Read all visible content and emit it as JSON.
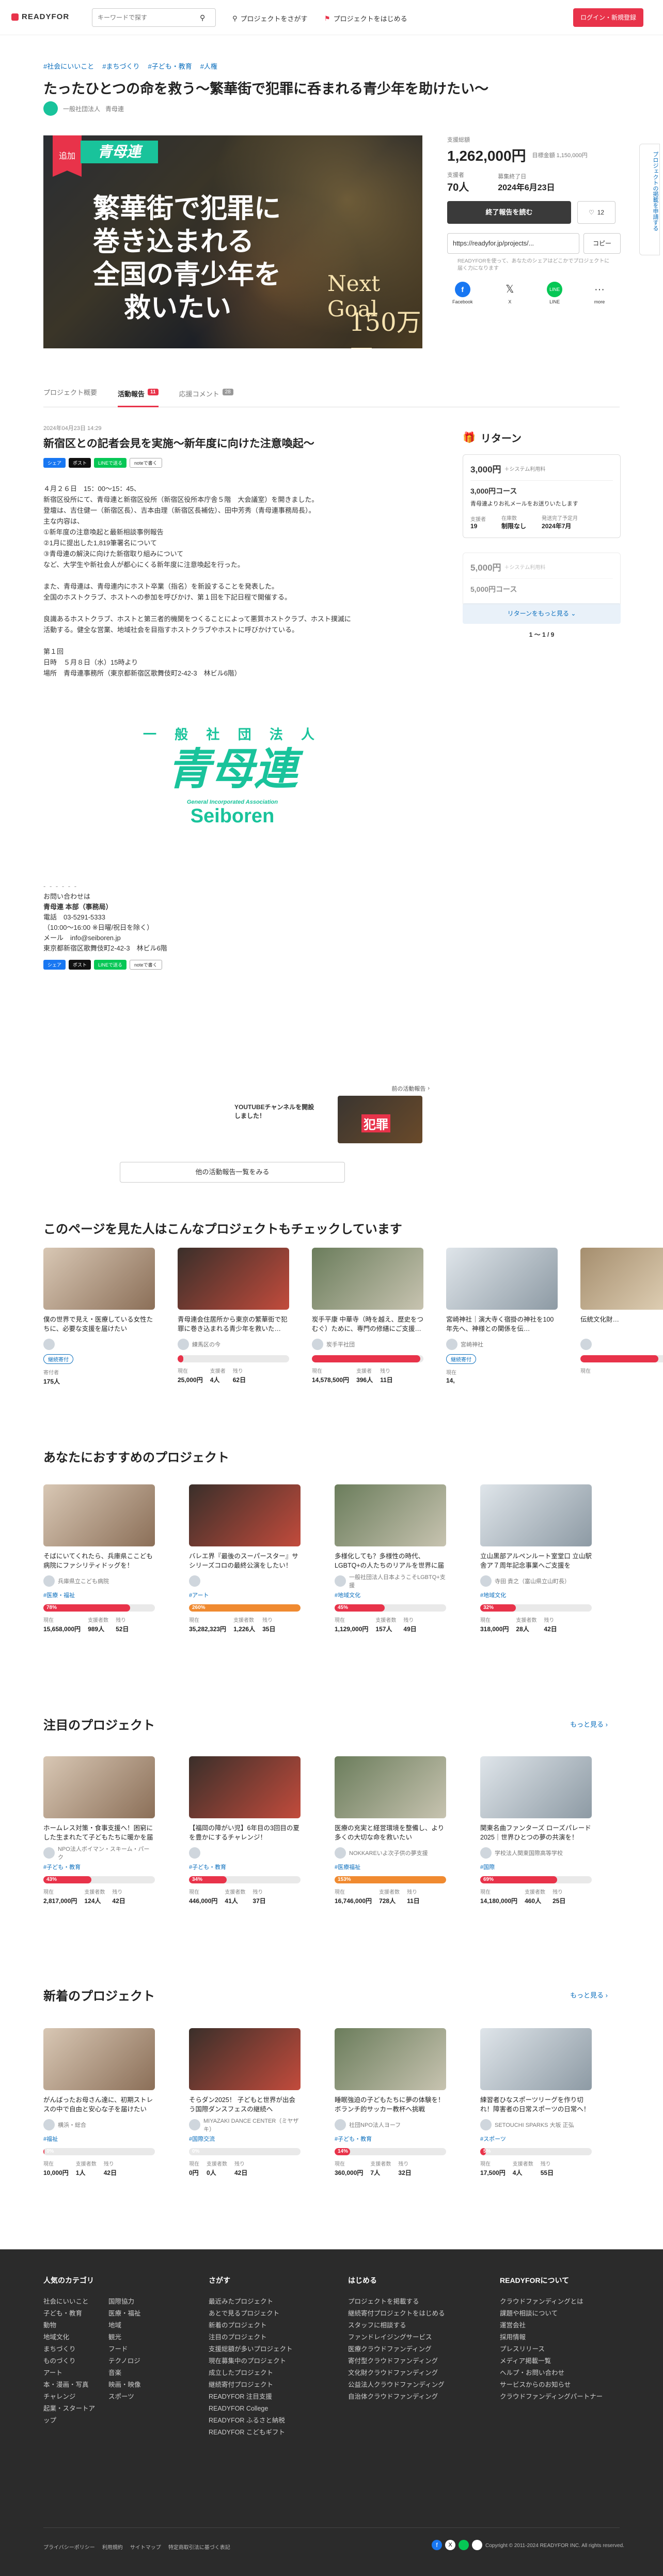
{
  "header": {
    "logo": "READYFOR",
    "search_placeholder": "キーワードで探す",
    "find": "プロジェクトをさがす",
    "start": "プロジェクトをはじめる",
    "login": "ログイン・新規登録"
  },
  "tags": [
    "#社会にいいこと",
    "#まちづくり",
    "#子ども・教育",
    "#人権"
  ],
  "title": "たったひとつの命を救う〜繁華街で犯罪に呑まれる青少年を助けたい〜",
  "org": {
    "label": "一般社団法人",
    "name": "青母連"
  },
  "hero": {
    "badge": "追加",
    "brand": "青母連",
    "line1": "繁華街で犯罪に",
    "line2": "巻き込まれる",
    "line3": "全国の青少年を",
    "line4": "救いたい",
    "goal_label": "Next Goal",
    "goal_amount": "150万円"
  },
  "funding": {
    "label": "支援総額",
    "amount": "1,262,000円",
    "target": "目標金額 1,150,000円",
    "supporters_label": "支援者",
    "supporters": "70人",
    "period_label": "募集終了日",
    "period": "2024年6月23日",
    "ended": "終了報告を読む",
    "fav": "12",
    "share_url": "https://readyfor.jp/projects/...",
    "copy": "コピー",
    "share_note": "READYFORを使って、あなたのシェアはどこかでプロジェクトに届く力になります",
    "sns": [
      "Facebook",
      "X",
      "LINE",
      "more"
    ]
  },
  "side_tab": "プロジェクトの掲載を申請する",
  "tabs": [
    {
      "label": "プロジェクト概要"
    },
    {
      "label": "活動報告",
      "count": "11"
    },
    {
      "label": "応援コメント",
      "count": "28"
    }
  ],
  "report": {
    "date": "2024年04月23日 14:29",
    "title": "新宿区との記者会見を実施〜新年度に向けた注意喚起〜",
    "share": "シェア",
    "post": "ポスト",
    "line": "LINEで送る",
    "note": "noteで書く",
    "paras": [
      "４月２６日　15：00〜15：45、",
      "新宿区役所にて、青母連と新宿区役所（新宿区役所本庁舎５階　大会議室）を開きました。",
      "登壇は、吉住健一（新宿区長）、吉本由理（新宿区長補佐）、田中芳秀（青母連事務局長）。",
      "主な内容は、",
      "①新年度の注意喚起と最新相談事例報告",
      "②1月に提出した1,819筆署名について",
      "③青母連の解決に向けた新宿取り組みについて",
      "など、大学生や新社会人が都心にくる新年度に注意喚起を行った。",
      "",
      "また、青母連は、青母連内にホスト卒業（指名）を新設することを発表した。",
      "全国のホストクラブ、ホストへの参加を呼びかけ、第１回を下記日程で開催する。",
      "",
      "良識あるホストクラブ、ホストと第三者的機関をつくることによって悪質ホストクラブ、ホスト撲滅に",
      "活動する。健全な営業、地域社会を目指すホストクラブやホストに呼びかけている。",
      "",
      "第１回",
      "日時　５月８日（水）15時より",
      "場所　青母連事務所（東京都新宿区歌舞伎町2-42-3　林ビル6階）"
    ],
    "logo_top": "一 般 社 団 法 人",
    "logo_main": "青母連",
    "logo_en1": "General Incorporated Association",
    "logo_en2": "Seiboren",
    "contact": [
      "お問い合わせは",
      "青母連 本部（事務局）",
      "電話　03-5291-5333",
      "（10:00〜16:00 ※日曜/祝日を除く）",
      "メール　info@seiboren.jp",
      "東京都新宿区歌舞伎町2-42-3　林ビル6階"
    ],
    "prev_label": "前の活動報告",
    "prev_title": "YOUTUBEチャンネルを開設しました！",
    "all_reports": "他の活動報告一覧をみる"
  },
  "returns": {
    "title": "リターン",
    "items": [
      {
        "price": "3,000円",
        "tax": "＋システム利用料",
        "name": "3,000円コース",
        "desc": "青母連よりお礼メールをお送りいたします",
        "s_label": "支援者",
        "s": "19",
        "r_label": "在庫数",
        "r": "制限なし",
        "d_label": "発送完了予定月",
        "d": "2024年7月"
      },
      {
        "price": "5,000円",
        "tax": "＋システム利用料",
        "name": "5,000円コース"
      }
    ],
    "more": "リターンをもっと見る",
    "pager": "1 〜 1 / 9"
  },
  "sec1": {
    "title": "このページを見た人はこんなプロジェクトもチェックしています",
    "cards": [
      {
        "title": "僕の世界で見え・医療している女性たちに、必要な支援を届けたい",
        "owner": "",
        "badge": "継続寄付",
        "s1l": "寄付者",
        "s1": "175人",
        "color": "#e8334a",
        "pct": 0
      },
      {
        "title": "青母連会住居所から東京の繁華街で犯罪に巻き込まれる青少年を救いた…",
        "owner": "練馬区の今",
        "badge": "",
        "s1l": "現在",
        "s1": "25,000円",
        "s2l": "支援者",
        "s2": "4人",
        "s3l": "残り",
        "s3": "62日",
        "color": "#e8334a",
        "pct": 5
      },
      {
        "title": "炭手平康 中華寺（時を越え、歴史をつむぐ）ために、専門の修繕にご支援…",
        "owner": "炭手平社団",
        "badge": "",
        "s1l": "現在",
        "s1": "14,578,500円",
        "s2l": "支援者",
        "s2": "396人",
        "s3l": "残り",
        "s3": "11日",
        "color": "#e8334a",
        "pct": 97
      },
      {
        "title": "宮崎神社｜演大寺く宿掛の神社を100年先へ、神様との関係を伝…",
        "owner": "宮崎神社",
        "badge": "継続寄付",
        "s1l": "現在",
        "s1": "14,",
        "color": "#e8334a",
        "pct": 0
      },
      {
        "title": "伝統文化財…",
        "owner": "",
        "badge": "",
        "s1l": "現在",
        "s1": "",
        "color": "#e8334a",
        "pct": 70
      }
    ]
  },
  "sec2": {
    "title": "あなたにおすすめのプロジェクト",
    "cards": [
      {
        "title": "そばにいてくれたら、兵庫県ここども病院にファシリティドッグを！",
        "owner": "兵庫県立こども病院",
        "tag": "#医療・福祉",
        "pct": "78%",
        "p": 78,
        "color": "#e8334a",
        "s1": "15,658,000円",
        "s2": "989人",
        "s3": "52日"
      },
      {
        "title": "バレエ界『最後のスーパースター』サシリーズコロの最終公演をしたい！",
        "owner": "",
        "tag": "#アート",
        "pct": "260%",
        "p": 100,
        "color": "#f08a30",
        "s1": "35,282,323円",
        "s2": "1,226人",
        "s3": "35日"
      },
      {
        "title": "多様化しても？多様性の時代、LGBTQ+の人たちのリアルを世界に届けたい",
        "owner": "一般社団法人日本ようこそLGBTQ+支援",
        "tag": "#地域文化",
        "pct": "45%",
        "p": 45,
        "color": "#e8334a",
        "s1": "1,129,000円",
        "s2": "157人",
        "s3": "49日"
      },
      {
        "title": "立山黒部アルペンルート室堂口 立山駅舎ア７周年記念事業へご支援を",
        "owner": "寺田 貴之（富山県立山町長）",
        "tag": "#地域文化",
        "pct": "32%",
        "p": 32,
        "color": "#e8334a",
        "s1": "318,000円",
        "s2": "28人",
        "s3": "42日"
      }
    ]
  },
  "sec3": {
    "title": "注目のプロジェクト",
    "more": "もっと見る",
    "cards": [
      {
        "title": "ホームレス対策・食事支援へ！困窮にした生まれたて子どもたちに暖かを届けたい",
        "owner": "NPO法人ボイマン・スキーム・パーク",
        "tag": "#子ども・教育",
        "pct": "43%",
        "p": 43,
        "color": "#e8334a",
        "s1": "2,817,000円",
        "s2": "124人",
        "s3": "42日"
      },
      {
        "title": "【福岡の障がい児】6年目の3回目の夏を豊かにするチャレンジ！",
        "owner": "",
        "tag": "#子ども・教育",
        "pct": "34%",
        "p": 34,
        "color": "#e8334a",
        "s1": "446,000円",
        "s2": "41人",
        "s3": "37日"
      },
      {
        "title": "医療の充実と経営環境を整備し、より多くの大切な命を救いたい",
        "owner": "NOKKAREいよ次子供の夢支援",
        "tag": "#医療福祉",
        "pct": "153%",
        "p": 100,
        "color": "#f08a30",
        "s1": "16,746,000円",
        "s2": "728人",
        "s3": "11日"
      },
      {
        "title": "関東名曲ファンターズ ローズパレード2025｜世界ひとつの夢の共演を！",
        "owner": "学校法人関東国際高等学校",
        "tag": "#国際",
        "pct": "69%",
        "p": 69,
        "color": "#e8334a",
        "s1": "14,180,000円",
        "s2": "460人",
        "s3": "25日"
      }
    ]
  },
  "sec4": {
    "title": "新着のプロジェクト",
    "more": "もっと見る",
    "cards": [
      {
        "title": "がんばったお母さん達に、初期ストレスの中で自由と安心な子を届けたい",
        "owner": "横浜・総合",
        "tag": "#福祉",
        "pct": "0%",
        "p": 1,
        "color": "#e8334a",
        "s1": "10,000円",
        "s2": "1人",
        "s3": "42日"
      },
      {
        "title": "そらダン2025！ 子どもと世界が出会う国際ダンスフェスの継続へ",
        "owner": "MIYAZAKI DANCE CENTER（ミヤザキ）",
        "tag": "#国際交流",
        "pct": "0%",
        "p": 0,
        "color": "#e8334a",
        "s1": "0円",
        "s2": "0人",
        "s3": "42日"
      },
      {
        "title": "睡眠強迫の子どもたちに夢の体験を！ボランチ的サッカー教杯へ挑戦",
        "owner": "社団NPO法人ヨーフ",
        "tag": "#子ども・教育",
        "pct": "14%",
        "p": 14,
        "color": "#e8334a",
        "s1": "360,000円",
        "s2": "7人",
        "s3": "32日"
      },
      {
        "title": "練習者ひなスポーツリーグを作り切れ！障害者の日常スポーツの日常へ！",
        "owner": "SETOUCHI SPARKS 大坂 正弘",
        "tag": "#スポーツ",
        "pct": "5%",
        "p": 5,
        "color": "#e8334a",
        "s1": "17,500円",
        "s2": "4人",
        "s3": "55日"
      }
    ]
  },
  "footer": {
    "cols": [
      {
        "title": "人気のカテゴリ",
        "links": [
          "社会にいいこと",
          "国際協力",
          "子ども・教育",
          "医療・福祉",
          "動物",
          "地域",
          "地域文化",
          "観光",
          "まちづくり",
          "フード",
          "ものづくり",
          "テクノロジ",
          "アート",
          "音楽",
          "本・漫画・写真",
          "映画・映像",
          "チャレンジ",
          "スポーツ",
          "起業・スタートアップ",
          ""
        ]
      },
      {
        "title": "さがす",
        "links": [
          "最近みたプロジェクト",
          "あとで見るプロジェクト",
          "新着のプロジェクト",
          "注目のプロジェクト",
          "支援総額が多いプロジェクト",
          "現在募集中のプロジェクト",
          "成立したプロジェクト",
          "継続寄付プロジェクト",
          "READYFOR 注目支援",
          "READYFOR College",
          "READYFOR ふるさと納税",
          "READYFOR こどもギフト"
        ]
      },
      {
        "title": "はじめる",
        "links": [
          "プロジェクトを掲載する",
          "継続寄付プロジェクトをはじめる",
          "スタッフに相談する",
          "ファンドレイジングサービス",
          "医療クラウドファンディング",
          "寄付型クラウドファンディング",
          "文化財クラウドファンディング",
          "公益法人クラウドファンディング",
          "自治体クラウドファンディング"
        ]
      },
      {
        "title": "READYFORについて",
        "links": [
          "クラウドファンディングとは",
          "課題や相談について",
          "運営会社",
          "採用情報",
          "プレスリリース",
          "メディア掲載一覧",
          "ヘルプ・お問い合わせ",
          "サービスからのお知らせ",
          "クラウドファンディングパートナー"
        ]
      }
    ],
    "bottom": [
      "プライバシーポリシー",
      "利用規約",
      "サイトマップ",
      "特定商取引法に基づく表記"
    ],
    "copyright": "Copyright © 2011-2024 READYFOR INC. All rights reserved."
  },
  "colors": {
    "accent": "#e8334a",
    "teal": "#1fae9b",
    "dark": "#3a3a3a",
    "brand_green": "#19c39b"
  }
}
